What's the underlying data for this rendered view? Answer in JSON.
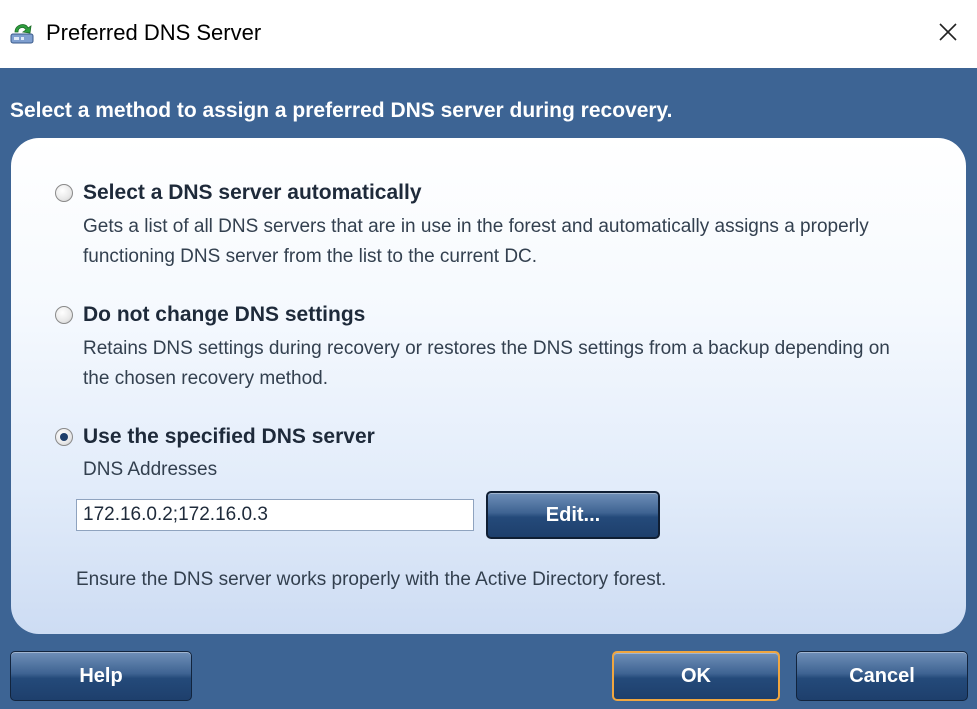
{
  "window": {
    "title": "Preferred DNS Server",
    "close_icon": "close-icon",
    "app_icon": "dns-server-icon"
  },
  "instruction": "Select a method to assign a preferred DNS server during recovery.",
  "options": [
    {
      "title": "Select a DNS server automatically",
      "description": "Gets a list of all DNS servers that are in use in the forest and automatically assigns a properly functioning DNS server from the list to the current DC.",
      "checked": false
    },
    {
      "title": "Do not change DNS settings",
      "description": "Retains DNS settings during recovery or restores the DNS settings from a backup depending on the chosen recovery method.",
      "checked": false
    },
    {
      "title": "Use the specified DNS server",
      "checked": true
    }
  ],
  "dns": {
    "label": "DNS Addresses",
    "value": "172.16.0.2;172.16.0.3",
    "edit_label": "Edit...",
    "note": "Ensure the DNS server works properly with the Active Directory forest."
  },
  "buttons": {
    "help": "Help",
    "ok": "OK",
    "cancel": "Cancel"
  },
  "colors": {
    "body_background": "#3d6494",
    "button_gradient_dark": "#1e3f6c",
    "ok_focus_border": "#f0a640",
    "panel_light": "#ffffff"
  }
}
